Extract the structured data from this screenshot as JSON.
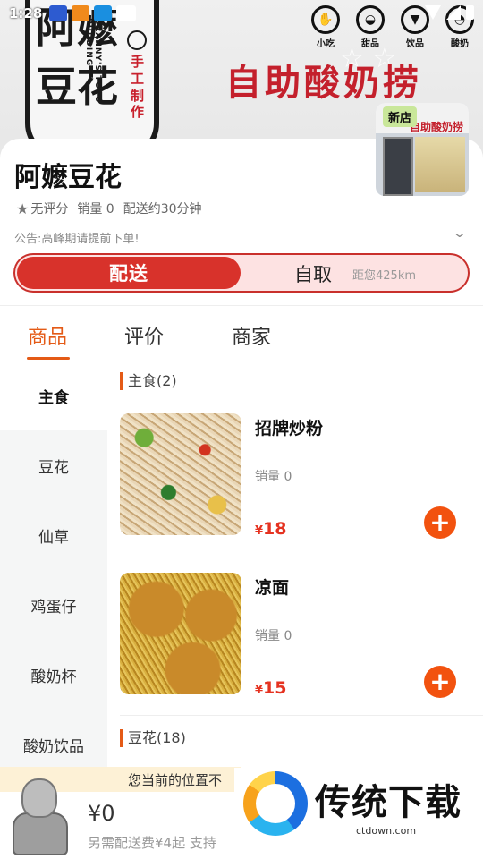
{
  "status_bar": {
    "time": "1:28"
  },
  "hero": {
    "logo_line1": "阿嬷",
    "logo_line2": "豆花",
    "logo_en": "GRANNY'S TOFU PUDDING",
    "handmade": "手工制作",
    "slogan": "自助酸奶捞",
    "menu_icons": [
      {
        "label": "小吃",
        "icon": "snack-icon"
      },
      {
        "label": "甜品",
        "icon": "dessert-icon"
      },
      {
        "label": "饮品",
        "icon": "drink-icon"
      },
      {
        "label": "酸奶",
        "icon": "yogurt-icon"
      }
    ]
  },
  "store": {
    "name": "阿嬷豆花",
    "new_badge": "新店",
    "photo_sign": "自助酸奶捞",
    "rating": "无评分",
    "sales": "销量 0",
    "delivery_time": "配送约30分钟",
    "notice": "公告:高峰期请提前下单!"
  },
  "toggle": {
    "delivery": "配送",
    "pickup": "自取",
    "distance": "距您425km"
  },
  "tabs": [
    {
      "label": "商品",
      "active": true
    },
    {
      "label": "评价",
      "active": false
    },
    {
      "label": "商家",
      "active": false
    }
  ],
  "categories": [
    {
      "label": "主食",
      "active": true
    },
    {
      "label": "豆花",
      "active": false
    },
    {
      "label": "仙草",
      "active": false
    },
    {
      "label": "鸡蛋仔",
      "active": false
    },
    {
      "label": "酸奶杯",
      "active": false
    },
    {
      "label": "酸奶饮品",
      "active": false
    }
  ],
  "sections": [
    {
      "title": "主食(2)",
      "products": [
        {
          "name": "招牌炒粉",
          "sales": "销量 0",
          "currency": "¥",
          "price": "18"
        },
        {
          "name": "凉面",
          "sales": "销量 0",
          "currency": "¥",
          "price": "15"
        }
      ]
    },
    {
      "title": "豆花(18)",
      "products": []
    }
  ],
  "bottom": {
    "location_tip": "您当前的位置不",
    "cart_total": "¥0",
    "delivery_fee_note": "另需配送费¥4起  支持"
  },
  "watermark": {
    "title": "传统下载",
    "url": "ctdown.com"
  },
  "colors": {
    "accent": "#e45a16",
    "delivery_red": "#d8322b",
    "price_red": "#e53220",
    "add_button": "#f2520f"
  }
}
